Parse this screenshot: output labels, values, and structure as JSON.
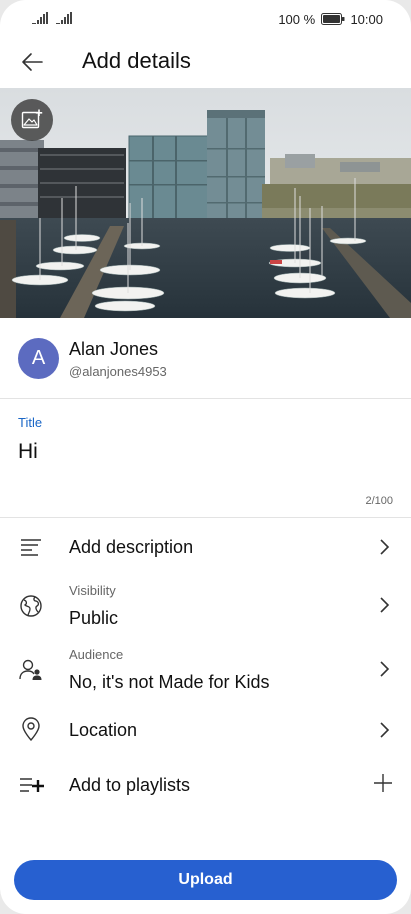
{
  "status_bar": {
    "battery": "100 %",
    "time": "10:00",
    "icons": [
      "signal-icon",
      "signal-icon",
      "battery-icon"
    ]
  },
  "header": {
    "title": "Add details",
    "back_icon": "arrow-left-icon"
  },
  "thumbnail": {
    "icon": "add-image-icon"
  },
  "account": {
    "initial": "A",
    "name": "Alan Jones",
    "handle": "@alanjones4953",
    "avatar_color": "#5c6bc0"
  },
  "title_field": {
    "label": "Title",
    "value": "Hi",
    "counter": "2/100"
  },
  "options": {
    "description": {
      "label": "Add description",
      "icon": "text-lines-icon"
    },
    "visibility": {
      "caption": "Visibility",
      "value": "Public",
      "icon": "globe-icon"
    },
    "audience": {
      "caption": "Audience",
      "value": "No, it's not Made for Kids",
      "icon": "people-icon"
    },
    "location": {
      "label": "Location",
      "icon": "location-pin-icon"
    },
    "playlists": {
      "label": "Add to playlists",
      "icon": "playlist-add-icon"
    }
  },
  "upload_button": {
    "label": "Upload",
    "color": "#2760d0"
  },
  "accent_color": "#1a66c6"
}
